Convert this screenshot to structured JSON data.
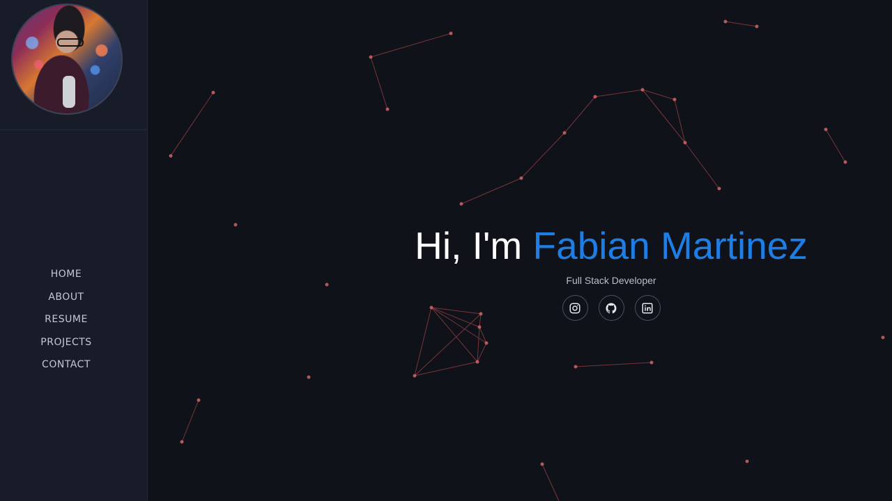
{
  "sidebar": {
    "nav": [
      "HOME",
      "ABOUT",
      "RESUME",
      "PROJECTS",
      "CONTACT"
    ]
  },
  "hero": {
    "greeting": "Hi, I'm",
    "name": "Fabian Martinez",
    "subtitle": "Full Stack Developer"
  },
  "socials": [
    {
      "icon": "instagram-icon"
    },
    {
      "icon": "github-icon"
    },
    {
      "icon": "linkedin-icon"
    }
  ],
  "colors": {
    "background": "#10121a",
    "sidebar": "#181c28",
    "accent": "#1d7ee6",
    "particle": "#d86a6a"
  }
}
